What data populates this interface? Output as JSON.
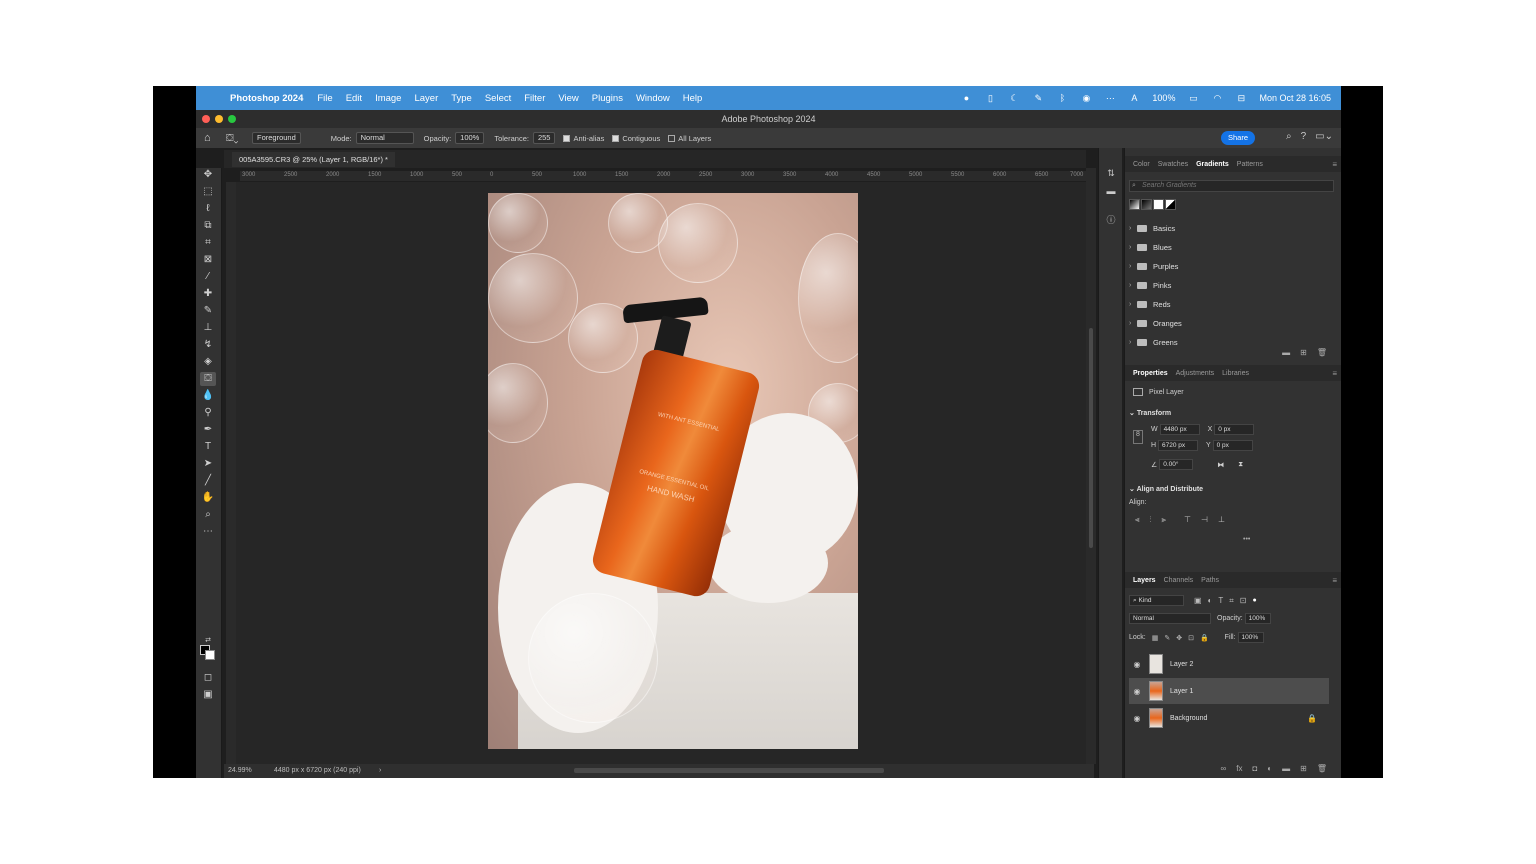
{
  "menubar": {
    "app": "Photoshop 2024",
    "items": [
      "File",
      "Edit",
      "Image",
      "Layer",
      "Type",
      "Select",
      "Filter",
      "View",
      "Plugins",
      "Window",
      "Help"
    ],
    "battery": "100%",
    "clock": "Mon Oct 28  16:05"
  },
  "window": {
    "title": "Adobe Photoshop 2024"
  },
  "options": {
    "fill_source": "Foreground",
    "mode_label": "Mode:",
    "mode_value": "Normal",
    "opacity_label": "Opacity:",
    "opacity_value": "100%",
    "tolerance_label": "Tolerance:",
    "tolerance_value": "255",
    "antialias_label": "Anti-alias",
    "contiguous_label": "Contiguous",
    "all_layers_label": "All Layers",
    "share_label": "Share"
  },
  "document": {
    "tab": "005A3595.CR3 @ 25% (Layer 1, RGB/16*) *",
    "ruler_ticks": [
      "3000",
      "2500",
      "2000",
      "1500",
      "1000",
      "500",
      "0",
      "500",
      "1000",
      "1500",
      "2000",
      "2500",
      "3000",
      "3500",
      "4000",
      "4500",
      "5000",
      "5500",
      "6000",
      "6500",
      "7000"
    ]
  },
  "bottle_label": {
    "line1": "WITH ANT ESSENTIAL",
    "line2": "ORANGE ESSENTIAL OIL",
    "line3": "HAND WASH"
  },
  "status": {
    "zoom": "24.99%",
    "dimensions": "4480 px x 6720 px (240 ppi)",
    "arrow": "›"
  },
  "gradients_panel": {
    "tabs": [
      "Color",
      "Swatches",
      "Gradients",
      "Patterns"
    ],
    "active_tab": "Gradients",
    "search_placeholder": "Search Gradients",
    "folders": [
      "Basics",
      "Blues",
      "Purples",
      "Pinks",
      "Reds",
      "Oranges",
      "Greens"
    ]
  },
  "properties_panel": {
    "tabs": [
      "Properties",
      "Adjustments",
      "Libraries"
    ],
    "layer_type": "Pixel Layer",
    "transform_title": "Transform",
    "w_label": "W",
    "w_value": "4480 px",
    "h_label": "H",
    "h_value": "6720 px",
    "x_label": "X",
    "x_value": "0 px",
    "y_label": "Y",
    "y_value": "0 px",
    "angle_value": "0.00°",
    "align_title": "Align and Distribute",
    "align_label": "Align:",
    "more": "•••"
  },
  "layers_panel": {
    "tabs": [
      "Layers",
      "Channels",
      "Paths"
    ],
    "kind_label": "Kind",
    "blend_mode": "Normal",
    "opacity_label": "Opacity:",
    "opacity_value": "100%",
    "lock_label": "Lock:",
    "fill_label": "Fill:",
    "fill_value": "100%",
    "layers": [
      "Layer 2",
      "Layer 1",
      "Background"
    ],
    "selected": "Layer 1"
  },
  "colors": {
    "menubar": "#3f8fd6",
    "share_button": "#1473e6",
    "bottle": "#e9661c"
  }
}
